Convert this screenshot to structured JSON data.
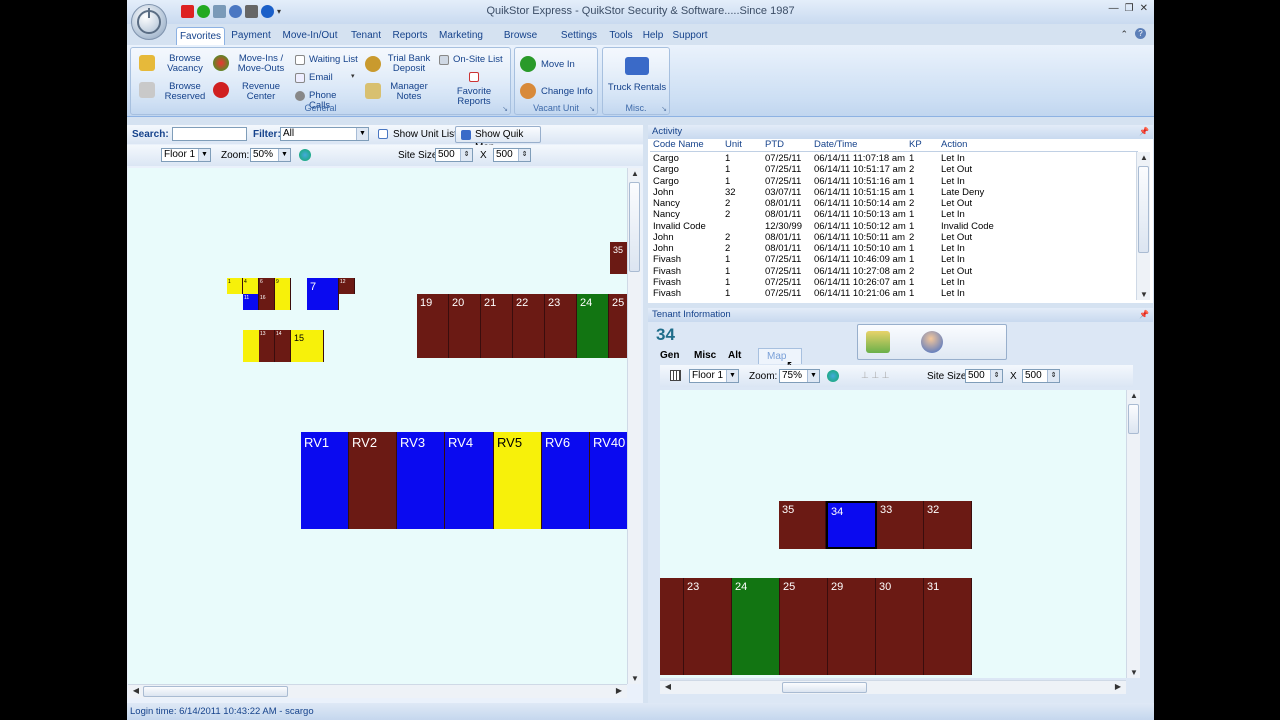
{
  "app": {
    "title": "QuikStor Express -    QuikStor Security & Software.....Since 1987",
    "window_buttons": [
      "—",
      "❐",
      "✕"
    ]
  },
  "menu_tabs": [
    "Favorites",
    "Payment",
    "Move-In/Out",
    "Tenant",
    "Reports",
    "Marketing",
    "Browse Data",
    "Settings",
    "Tools",
    "Help",
    "Support"
  ],
  "ribbon": {
    "general": {
      "label": "General",
      "browse_vacancy": "Browse Vacancy",
      "browse_reserved": "Browse Reserved",
      "move_ins_outs": "Move-Ins / Move-Outs",
      "revenue_center": "Revenue Center",
      "waiting_list": "Waiting List",
      "email": "Email",
      "phone_calls": "Phone Calls",
      "trial_bank_deposit": "Trial Bank Deposit",
      "manager_notes": "Manager Notes",
      "onsite_list": "On-Site List",
      "favorite_reports": "Favorite Reports"
    },
    "vacant_unit": {
      "label": "Vacant Unit",
      "move_in": "Move In",
      "change_info": "Change Info"
    },
    "misc": {
      "label": "Misc.",
      "truck_rentals": "Truck Rentals"
    }
  },
  "left": {
    "search_label": "Search:",
    "search_value": "",
    "filter_label": "Filter:",
    "filter_value": "All",
    "show_unit_list": "Show Unit List",
    "show_quik_map": "Show Quik Map",
    "floor_value": "Floor 1",
    "zoom_label": "Zoom:",
    "zoom_value": "50%",
    "site_size_label": "Site Size:",
    "site_w": "500",
    "x_sep": "X",
    "site_h": "500",
    "units": [
      {
        "label": "35",
        "color": "#6b1a14"
      },
      {
        "label": "19",
        "color": "#6b1a14"
      },
      {
        "label": "20",
        "color": "#6b1a14"
      },
      {
        "label": "21",
        "color": "#6b1a14"
      },
      {
        "label": "22",
        "color": "#6b1a14"
      },
      {
        "label": "23",
        "color": "#6b1a14"
      },
      {
        "label": "24",
        "color": "#127512"
      },
      {
        "label": "25",
        "color": "#6b1a14"
      },
      {
        "label": "7",
        "color": "#0a0af0"
      },
      {
        "label": "15",
        "color": "#f7f10a"
      },
      {
        "label": "RV1",
        "color": "#0a0af0"
      },
      {
        "label": "RV2",
        "color": "#6b1a14"
      },
      {
        "label": "RV3",
        "color": "#0a0af0"
      },
      {
        "label": "RV4",
        "color": "#0a0af0"
      },
      {
        "label": "RV5",
        "color": "#f7f10a"
      },
      {
        "label": "RV6",
        "color": "#0a0af0"
      },
      {
        "label": "RV40",
        "color": "#0a0af0"
      },
      {
        "label": "1",
        "color": "#f7f10a"
      },
      {
        "label": "4",
        "color": "#f7f10a"
      },
      {
        "label": "6",
        "color": "#6b1a14"
      },
      {
        "label": "9",
        "color": "#f7f10a"
      },
      {
        "label": "12",
        "color": "#6b1a14"
      },
      {
        "label": "11",
        "color": "#0a0af0"
      },
      {
        "label": "16",
        "color": "#6b1a14"
      },
      {
        "label": "13",
        "color": "#6b1a14"
      },
      {
        "label": "14",
        "color": "#6b1a14"
      }
    ]
  },
  "activity": {
    "title": "Activity",
    "columns": [
      "Code Name",
      "Unit",
      "PTD",
      "Date/Time",
      "KP",
      "Action"
    ],
    "rows": [
      [
        "Cargo",
        "1",
        "07/25/11",
        "06/14/11 11:07:18 am",
        "1",
        "Let In"
      ],
      [
        "Cargo",
        "1",
        "07/25/11",
        "06/14/11 10:51:17 am",
        "2",
        "Let Out"
      ],
      [
        "Cargo",
        "1",
        "07/25/11",
        "06/14/11 10:51:16 am",
        "1",
        "Let In"
      ],
      [
        "John",
        "32",
        "03/07/11",
        "06/14/11 10:51:15 am",
        "1",
        "Late Deny"
      ],
      [
        "Nancy",
        "2",
        "08/01/11",
        "06/14/11 10:50:14 am",
        "2",
        "Let Out"
      ],
      [
        "Nancy",
        "2",
        "08/01/11",
        "06/14/11 10:50:13 am",
        "1",
        "Let In"
      ],
      [
        "Invalid Code",
        "",
        "12/30/99",
        "06/14/11 10:50:12 am",
        "1",
        "Invalid Code"
      ],
      [
        "John",
        "2",
        "08/01/11",
        "06/14/11 10:50:11 am",
        "2",
        "Let Out"
      ],
      [
        "John",
        "2",
        "08/01/11",
        "06/14/11 10:50:10 am",
        "1",
        "Let In"
      ],
      [
        "Fivash",
        "1",
        "07/25/11",
        "06/14/11 10:46:09 am",
        "1",
        "Let In"
      ],
      [
        "Fivash",
        "1",
        "07/25/11",
        "06/14/11 10:27:08 am",
        "2",
        "Let Out"
      ],
      [
        "Fivash",
        "1",
        "07/25/11",
        "06/14/11 10:26:07 am",
        "1",
        "Let In"
      ],
      [
        "Fivash",
        "1",
        "07/25/11",
        "06/14/11 10:21:06 am",
        "1",
        "Let In"
      ]
    ]
  },
  "tenant": {
    "title": "Tenant Information",
    "unit_number": "34",
    "tabs": [
      "Gen",
      "Misc",
      "Alt",
      "Map"
    ],
    "floor_value": "Floor 1",
    "zoom_label": "Zoom:",
    "zoom_value": "75%",
    "site_size_label": "Site Size:",
    "site_w": "500",
    "x_sep": "X",
    "site_h": "500",
    "units": [
      {
        "label": "35",
        "color": "#6b1a14"
      },
      {
        "label": "34",
        "color": "#0a0af0"
      },
      {
        "label": "33",
        "color": "#6b1a14"
      },
      {
        "label": "32",
        "color": "#6b1a14"
      },
      {
        "label": "",
        "color": "#6b1a14"
      },
      {
        "label": "23",
        "color": "#6b1a14"
      },
      {
        "label": "24",
        "color": "#127512"
      },
      {
        "label": "25",
        "color": "#6b1a14"
      },
      {
        "label": "29",
        "color": "#6b1a14"
      },
      {
        "label": "30",
        "color": "#6b1a14"
      },
      {
        "label": "31",
        "color": "#6b1a14"
      }
    ]
  },
  "status": {
    "login": "Login time: 6/14/2011 10:43:22 AM - scargo"
  }
}
